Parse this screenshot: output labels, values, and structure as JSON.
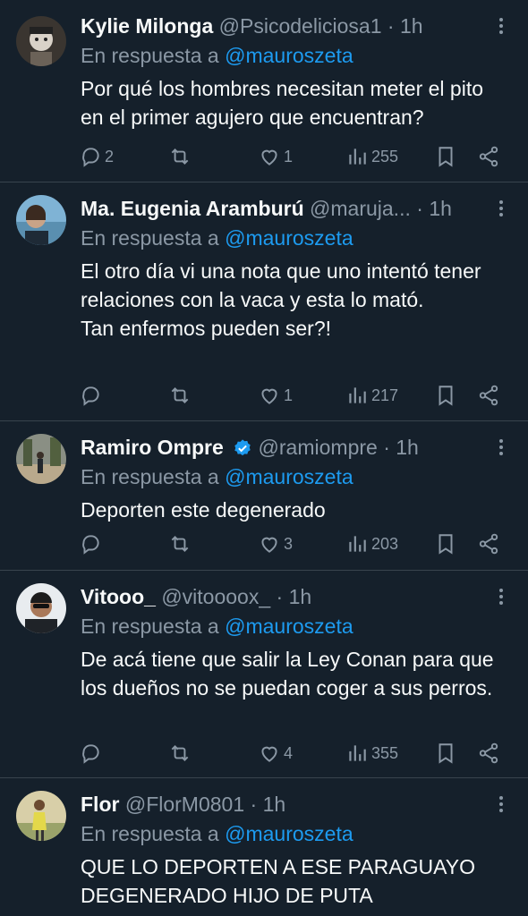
{
  "colors": {
    "background": "#15202b",
    "text": "#f7f9f9",
    "muted": "#8b98a5",
    "link": "#1d9bf0",
    "divider": "#38444d"
  },
  "tweets": [
    {
      "name": "Kylie Milonga",
      "handle": "@Psicodeliciosa1",
      "dot": "·",
      "time": "1h",
      "reply_prefix": "En respuesta a",
      "reply_to": "@mauroszeta",
      "text": "Por qué los hombres necesitan meter el pito en el primer agujero que encuentran?",
      "replies": "2",
      "retweets": "",
      "likes": "1",
      "views": "255",
      "verified": false
    },
    {
      "name": "Ma. Eugenia Aramburú",
      "handle": "@maruja...",
      "dot": "·",
      "time": "1h",
      "reply_prefix": "En respuesta a",
      "reply_to": "@mauroszeta",
      "text": "El otro día vi una nota que uno intentó tener relaciones con la vaca y esta lo mató.\nTan enfermos pueden ser?!",
      "replies": "",
      "retweets": "",
      "likes": "1",
      "views": "217",
      "verified": false
    },
    {
      "name": "Ramiro Ompre",
      "handle": "@ramiompre",
      "dot": "·",
      "time": "1h",
      "reply_prefix": "En respuesta a",
      "reply_to": "@mauroszeta",
      "text": "Deporten este degenerado",
      "replies": "",
      "retweets": "",
      "likes": "3",
      "views": "203",
      "verified": true
    },
    {
      "name": "Vitooo_",
      "handle": "@vitoooox_",
      "dot": "·",
      "time": "1h",
      "reply_prefix": "En respuesta a",
      "reply_to": "@mauroszeta",
      "text": "De acá tiene que salir la Ley Conan para que los dueños no se puedan coger a sus perros.",
      "replies": "",
      "retweets": "",
      "likes": "4",
      "views": "355",
      "verified": false
    },
    {
      "name": "Flor",
      "handle": "@FlorM0801",
      "dot": "·",
      "time": "1h",
      "reply_prefix": "En respuesta a",
      "reply_to": "@mauroszeta",
      "text": "QUE LO DEPORTEN A ESE PARAGUAYO DEGENERADO HIJO DE PUTA",
      "replies": "",
      "retweets": "",
      "likes": "",
      "views": "",
      "verified": false
    }
  ],
  "icons": {
    "reply": "reply-icon",
    "retweet": "retweet-icon",
    "like": "heart-icon",
    "views": "views-icon",
    "bookmark": "bookmark-icon",
    "share": "share-icon",
    "more": "more-icon",
    "verified": "verified-badge-icon"
  }
}
